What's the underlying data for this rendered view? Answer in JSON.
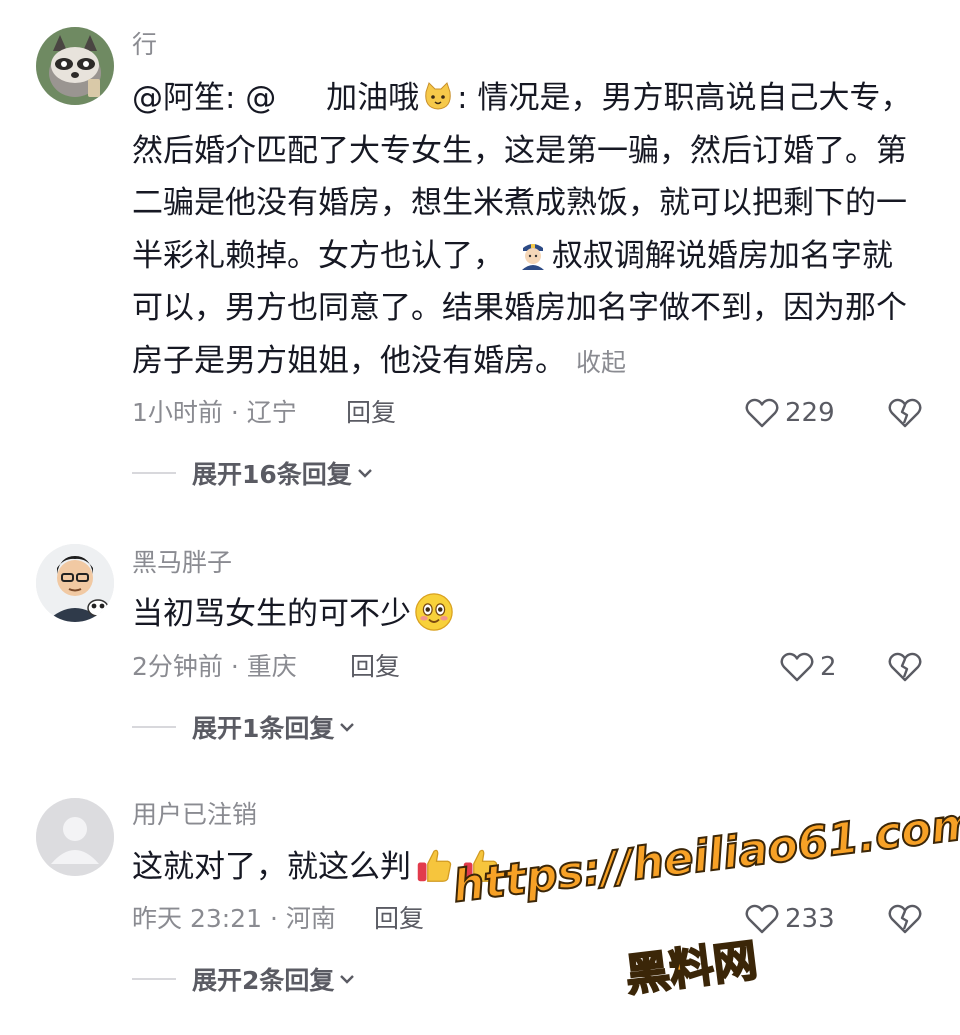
{
  "comments": [
    {
      "username": "行",
      "avatar": "raccoon-avatar",
      "content": {
        "prefix": "@阿笙: @",
        "mention": "加油哦",
        "mention_emoji": "cat-emoji",
        "text1": ": 情况是，男方职高说自己大专，然后婚介匹配了大专女生，这是第一骗，然后订婚了。第二骗是他没有婚房，想生米煮成熟饭，就可以把剩下的一半彩礼赖掉。女方也认了，",
        "inline_emoji": "police-officer-emoji",
        "text2": "叔叔调解说婚房加名字就可以，男方也同意了。结果婚房加名字做不到，因为那个房子是男方姐姐，他没有婚房。",
        "collapse_label": "收起"
      },
      "meta": "1小时前 · 辽宁",
      "reply_label": "回复",
      "likes": "229",
      "expand_label": "展开16条回复"
    },
    {
      "username": "黑马胖子",
      "avatar": "cartoon-man-avatar",
      "content": {
        "text": "当初骂女生的可不少",
        "emoji": "smile-emoji"
      },
      "meta": "2分钟前 · 重庆",
      "reply_label": "回复",
      "likes": "2",
      "expand_label": "展开1条回复"
    },
    {
      "username": "用户已注销",
      "avatar": "default-user-avatar",
      "content": {
        "text": "这就对了，就这么判",
        "emojis": [
          "thumbs-up-emoji",
          "thumbs-up-emoji"
        ]
      },
      "meta": "昨天 23:21 · 河南",
      "reply_label": "回复",
      "likes": "233",
      "expand_label": "展开2条回复"
    }
  ],
  "watermark": {
    "url": "https://heiliao61.com",
    "name": "黑料网"
  },
  "colors": {
    "text": "#161823",
    "secondary": "#8a8b91",
    "action": "#5a5b63",
    "watermark": "#f7a126"
  }
}
